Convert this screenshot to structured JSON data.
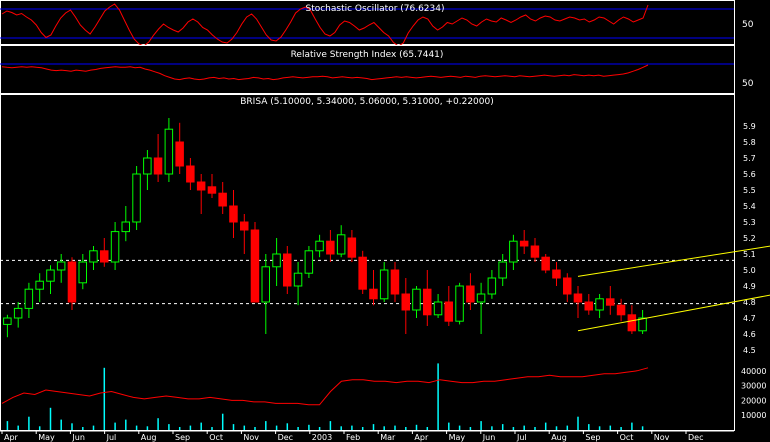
{
  "colors": {
    "background": "#000000",
    "frame": "#ffffff",
    "oscillator_line": "#ff0000",
    "overbought_oversold_line": "#0000ff",
    "bullish_candle": "#00ff00",
    "bearish_candle": "#ff0000",
    "channel_line": "#ffff00",
    "support_resistance_line": "#ffffff",
    "volume_bar": "#00ffff",
    "volume_ma_line": "#ff0000",
    "text": "#ffffff"
  },
  "chart_data": [
    {
      "panel": "stochastic",
      "type": "line",
      "title": "Stochastic Oscillator (76.6234)",
      "ylim": [
        0,
        100
      ],
      "reference_levels": [
        20,
        80
      ],
      "y_ticks": [
        "50"
      ],
      "values": [
        72,
        78,
        75,
        70,
        73,
        66,
        60,
        50,
        35,
        25,
        30,
        48,
        64,
        74,
        80,
        66,
        50,
        40,
        32,
        46,
        62,
        78,
        86,
        92,
        80,
        60,
        40,
        22,
        12,
        8,
        16,
        30,
        42,
        52,
        45,
        40,
        36,
        44,
        56,
        62,
        56,
        45,
        40,
        30,
        22,
        16,
        14,
        22,
        35,
        52,
        66,
        72,
        62,
        46,
        30,
        20,
        18,
        26,
        40,
        56,
        74,
        82,
        86,
        80,
        62,
        45,
        32,
        28,
        35,
        50,
        58,
        55,
        48,
        40,
        44,
        50,
        55,
        45,
        35,
        28,
        15,
        8,
        14,
        34,
        48,
        60,
        66,
        62,
        48,
        40,
        46,
        55,
        52,
        58,
        64,
        60,
        52,
        48,
        56,
        62,
        58,
        56,
        64,
        60,
        55,
        60,
        66,
        70,
        62,
        58,
        64,
        68,
        66,
        60,
        58,
        62,
        66,
        64,
        60,
        62,
        56,
        60,
        66,
        64,
        58,
        52,
        60,
        66,
        62,
        56,
        60,
        64,
        90
      ]
    },
    {
      "panel": "rsi",
      "type": "line",
      "title": "Relative Strength Index (65.7441)",
      "ylim": [
        0,
        100
      ],
      "reference_levels": [
        30,
        70
      ],
      "y_ticks": [
        "50"
      ],
      "values": [
        63,
        62,
        61,
        62,
        63,
        62,
        63,
        62,
        61,
        59,
        57,
        56,
        57,
        56,
        55,
        57,
        56,
        55,
        57,
        58,
        60,
        61,
        62,
        63,
        62,
        62,
        63,
        61,
        62,
        59,
        57,
        54,
        51,
        47,
        44,
        41,
        40,
        42,
        43,
        41,
        40,
        41,
        43,
        44,
        42,
        43,
        41,
        42,
        40,
        41,
        42,
        44,
        43,
        41,
        42,
        40,
        41,
        43,
        44,
        45,
        44,
        43,
        44,
        45,
        45,
        46,
        45,
        43,
        44,
        45,
        44,
        43,
        44,
        43,
        42,
        40,
        41,
        42,
        43,
        44,
        45,
        44,
        45,
        44,
        43,
        44,
        45,
        46,
        45,
        44,
        45,
        46,
        45,
        44,
        46,
        45,
        44,
        46,
        47,
        46,
        45,
        46,
        47,
        46,
        45,
        47,
        46,
        45,
        46,
        47,
        48,
        47,
        46,
        47,
        48,
        47,
        49,
        48,
        47,
        48,
        47,
        48,
        46,
        47,
        48,
        49,
        50,
        52,
        55,
        58,
        62,
        66
      ]
    },
    {
      "panel": "price",
      "type": "candlestick",
      "title": "BRISA (5.10000, 5.34000, 5.06000, 5.31000, +0.22000)",
      "ylim": [
        4.5,
        6.0
      ],
      "y_ticks": [
        "5.9",
        "5.8",
        "5.7",
        "5.6",
        "5.5",
        "5.4",
        "5.3",
        "5.2",
        "5.1",
        "5.0",
        "4.9",
        "4.8",
        "4.7",
        "4.6",
        "4.5"
      ],
      "x_ticks": [
        "Apr",
        "May",
        "Jun",
        "Jul",
        "Aug",
        "Sep",
        "Oct",
        "Nov",
        "Dec",
        "2003",
        "Feb",
        "Mar",
        "Apr",
        "May",
        "Jun",
        "Jul",
        "Aug",
        "Sep",
        "Oct",
        "Nov",
        "Dec"
      ],
      "reference_lines": [
        5.06,
        4.79
      ],
      "channel": {
        "start_x": 53,
        "end_x": 85,
        "upper": [
          4.96,
          5.3
        ],
        "lower": [
          4.62,
          5.02
        ]
      },
      "ohlc": [
        [
          4.66,
          4.72,
          4.58,
          4.7
        ],
        [
          4.7,
          4.8,
          4.64,
          4.76
        ],
        [
          4.76,
          4.92,
          4.7,
          4.88
        ],
        [
          4.88,
          4.98,
          4.8,
          4.93
        ],
        [
          4.93,
          5.03,
          4.85,
          5.0
        ],
        [
          5.0,
          5.1,
          4.92,
          5.05
        ],
        [
          5.05,
          5.08,
          4.75,
          4.8
        ],
        [
          4.92,
          5.1,
          4.88,
          5.05
        ],
        [
          5.05,
          5.15,
          5.0,
          5.12
        ],
        [
          5.12,
          5.2,
          5.02,
          5.05
        ],
        [
          5.05,
          5.3,
          5.0,
          5.24
        ],
        [
          5.24,
          5.4,
          5.18,
          5.3
        ],
        [
          5.3,
          5.65,
          5.25,
          5.6
        ],
        [
          5.6,
          5.75,
          5.5,
          5.7
        ],
        [
          5.7,
          5.85,
          5.55,
          5.6
        ],
        [
          5.6,
          5.95,
          5.55,
          5.88
        ],
        [
          5.8,
          5.92,
          5.6,
          5.65
        ],
        [
          5.65,
          5.7,
          5.5,
          5.55
        ],
        [
          5.55,
          5.6,
          5.35,
          5.5
        ],
        [
          5.52,
          5.6,
          5.45,
          5.48
        ],
        [
          5.48,
          5.55,
          5.35,
          5.4
        ],
        [
          5.4,
          5.5,
          5.2,
          5.3
        ],
        [
          5.3,
          5.35,
          5.1,
          5.25
        ],
        [
          5.25,
          5.3,
          4.8,
          4.8
        ],
        [
          4.8,
          5.1,
          4.6,
          5.02
        ],
        [
          5.02,
          5.2,
          4.9,
          5.1
        ],
        [
          5.1,
          5.15,
          4.85,
          4.9
        ],
        [
          4.9,
          5.05,
          4.78,
          4.98
        ],
        [
          4.98,
          5.15,
          4.95,
          5.12
        ],
        [
          5.12,
          5.22,
          5.08,
          5.18
        ],
        [
          5.18,
          5.25,
          5.05,
          5.1
        ],
        [
          5.1,
          5.28,
          5.08,
          5.22
        ],
        [
          5.2,
          5.25,
          5.05,
          5.08
        ],
        [
          5.08,
          5.12,
          4.85,
          4.88
        ],
        [
          4.88,
          5.0,
          4.78,
          4.82
        ],
        [
          4.82,
          5.05,
          4.8,
          5.0
        ],
        [
          5.0,
          5.05,
          4.8,
          4.85
        ],
        [
          4.85,
          4.95,
          4.6,
          4.75
        ],
        [
          4.75,
          4.9,
          4.7,
          4.88
        ],
        [
          4.88,
          5.0,
          4.65,
          4.72
        ],
        [
          4.72,
          4.85,
          4.7,
          4.8
        ],
        [
          4.8,
          4.9,
          4.65,
          4.68
        ],
        [
          4.68,
          4.92,
          4.66,
          4.9
        ],
        [
          4.9,
          4.98,
          4.75,
          4.8
        ],
        [
          4.8,
          4.92,
          4.6,
          4.85
        ],
        [
          4.85,
          5.0,
          4.82,
          4.95
        ],
        [
          4.95,
          5.1,
          4.9,
          5.05
        ],
        [
          5.05,
          5.22,
          5.0,
          5.18
        ],
        [
          5.18,
          5.25,
          5.1,
          5.15
        ],
        [
          5.15,
          5.2,
          5.05,
          5.08
        ],
        [
          5.08,
          5.1,
          4.98,
          5.0
        ],
        [
          5.0,
          5.05,
          4.9,
          4.95
        ],
        [
          4.95,
          4.98,
          4.8,
          4.85
        ],
        [
          4.85,
          4.9,
          4.7,
          4.8
        ],
        [
          4.8,
          4.85,
          4.72,
          4.75
        ],
        [
          4.75,
          4.85,
          4.7,
          4.82
        ],
        [
          4.82,
          4.9,
          4.72,
          4.78
        ],
        [
          4.78,
          4.82,
          4.68,
          4.72
        ],
        [
          4.72,
          4.78,
          4.6,
          4.62
        ],
        [
          4.62,
          4.75,
          4.6,
          4.7
        ]
      ],
      "volume": {
        "ylim": [
          0,
          50000
        ],
        "y_ticks": [
          "40000",
          "30000",
          "20000",
          "10000"
        ],
        "bars": [
          6000,
          3000,
          9000,
          2500,
          15000,
          7000,
          4500,
          2000,
          3000,
          42000,
          5000,
          7000,
          3000,
          2500,
          8000,
          4000,
          2000,
          3000,
          5000,
          2000,
          11000,
          4000,
          3000,
          2000,
          6000,
          3000,
          4500,
          2000,
          3500,
          2000,
          6000,
          2500,
          3000,
          2000,
          4000,
          2500,
          3000,
          2000,
          3500,
          2000,
          45000,
          5000,
          3000,
          2000,
          6000,
          2500,
          4000,
          2000,
          3000,
          2000,
          5000,
          2500,
          3000,
          9000,
          4000,
          2500,
          3000,
          2000,
          5000,
          2500
        ],
        "ma": [
          18000,
          22000,
          25000,
          24000,
          27000,
          26000,
          25000,
          24000,
          23000,
          25000,
          26000,
          24000,
          22000,
          21000,
          22000,
          23000,
          22000,
          21000,
          21000,
          22000,
          21000,
          20000,
          20000,
          19000,
          19000,
          18000,
          18000,
          18000,
          17000,
          17000,
          26000,
          33000,
          34000,
          34000,
          33000,
          33000,
          32000,
          33000,
          33000,
          32000,
          34000,
          33000,
          32000,
          32000,
          33000,
          33000,
          34000,
          35000,
          36000,
          36000,
          37000,
          36000,
          36000,
          36000,
          37000,
          38000,
          38000,
          39000,
          40000,
          42000
        ]
      }
    }
  ]
}
